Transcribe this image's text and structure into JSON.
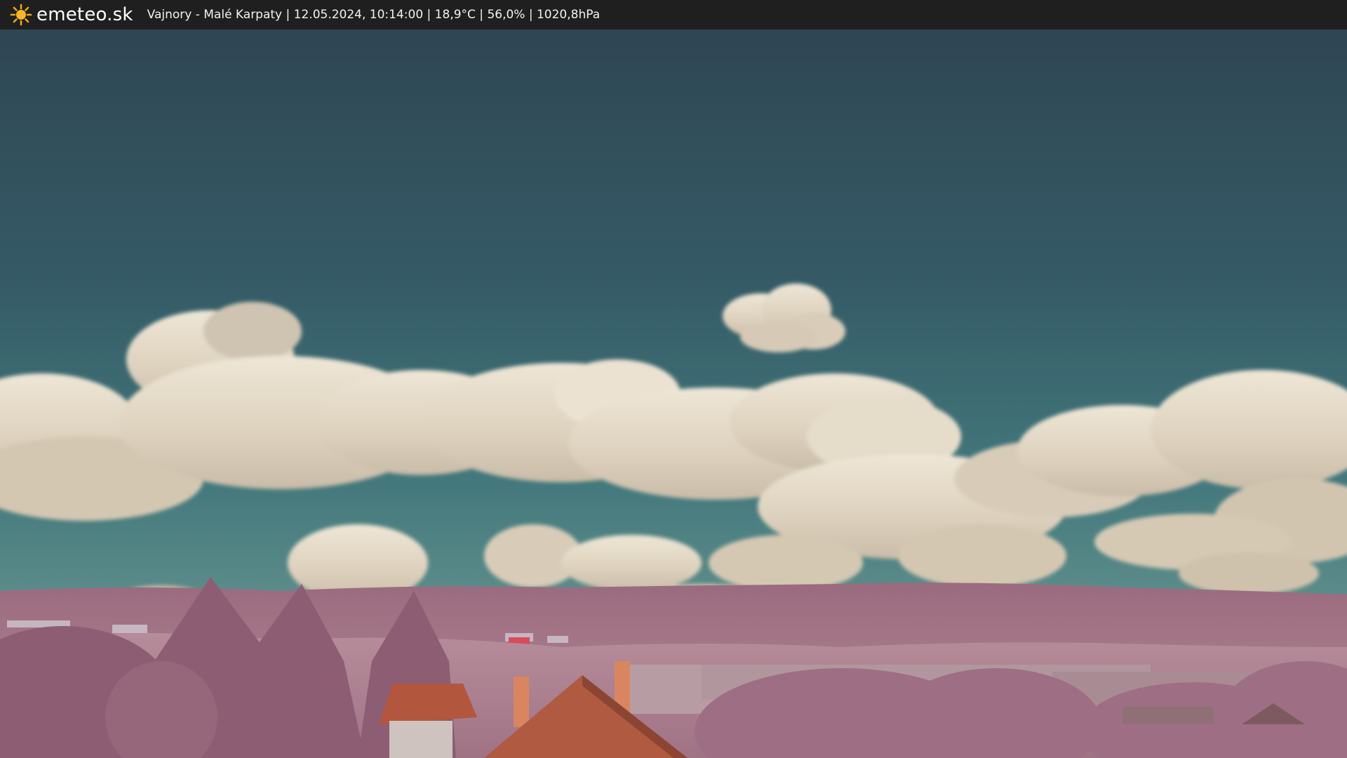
{
  "header": {
    "brand": "emeteo.sk",
    "logo_icon": "sun-icon",
    "caption": "Vajnory - Malé Karpaty | 12.05.2024, 10:14:00 | 18,9°C | 56,0% | 1020,8hPa"
  },
  "colors": {
    "bar_background": "#1f1f1f",
    "sun": "#f3a51e",
    "sky_top": "#2f4654",
    "sky_horizon": "#4e8384",
    "cloud": "#e6dccb",
    "vegetation": "#a77a8e",
    "roof": "#b3563e"
  }
}
